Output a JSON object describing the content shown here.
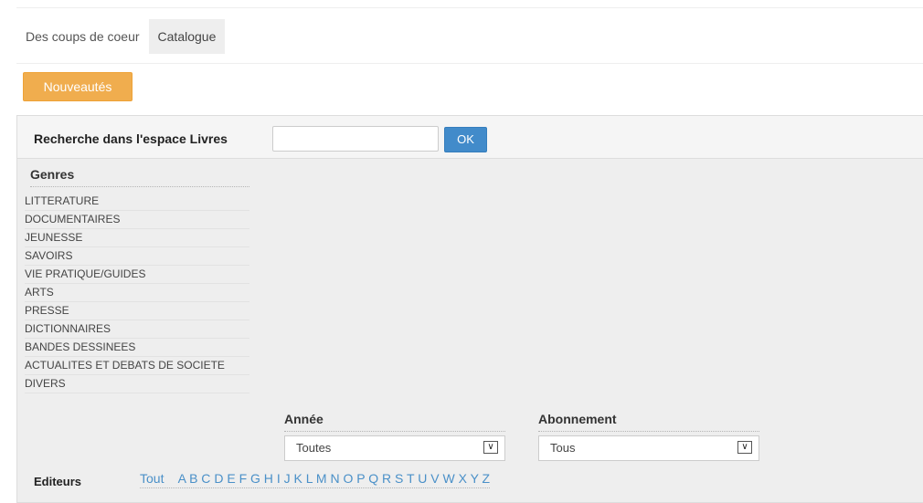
{
  "tabs": [
    {
      "label": "Des coups de coeur",
      "active": false
    },
    {
      "label": "Catalogue",
      "active": true
    }
  ],
  "new_button": {
    "label": "Nouveautés",
    "color": "#f0ad4e"
  },
  "search": {
    "label": "Recherche dans l'espace Livres",
    "value": "",
    "placeholder": "",
    "ok_label": "OK",
    "ok_color": "#428bca"
  },
  "genres": {
    "heading": "Genres",
    "items": [
      "LITTERATURE",
      "DOCUMENTAIRES",
      "JEUNESSE",
      "SAVOIRS",
      "VIE PRATIQUE/GUIDES",
      "ARTS",
      "PRESSE",
      "DICTIONNAIRES",
      "BANDES DESSINEES",
      "ACTUALITES ET DEBATS DE SOCIETE",
      "DIVERS"
    ]
  },
  "annee": {
    "heading": "Année",
    "selected": "Toutes"
  },
  "abonnement": {
    "heading": "Abonnement",
    "selected": "Tous"
  },
  "editeurs": {
    "label": "Editeurs",
    "all_label": "Tout",
    "letters": [
      "A",
      "B",
      "C",
      "D",
      "E",
      "F",
      "G",
      "H",
      "I",
      "J",
      "K",
      "L",
      "M",
      "N",
      "O",
      "P",
      "Q",
      "R",
      "S",
      "T",
      "U",
      "V",
      "W",
      "X",
      "Y",
      "Z"
    ],
    "link_color": "#4a90c8"
  }
}
